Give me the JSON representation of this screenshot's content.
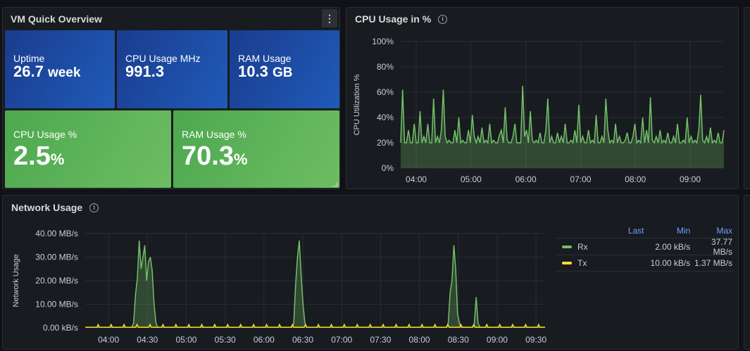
{
  "overview": {
    "title": "VM Quick Overview",
    "menu_icon": "⋮",
    "uptime": {
      "label": "Uptime",
      "value": "26.7",
      "unit": "week"
    },
    "cpu_mhz": {
      "label": "CPU Usage MHz",
      "value": "991.3",
      "unit": ""
    },
    "ram": {
      "label": "RAM Usage",
      "value": "10.3",
      "unit": "GB"
    },
    "cpu_pct": {
      "label": "CPU Usage %",
      "value": "2.5",
      "unit": "%"
    },
    "ram_pct": {
      "label": "RAM Usage %",
      "value": "70.3",
      "unit": "%"
    },
    "colors": {
      "blue": "#1f5bb8",
      "green": "#5fb45a"
    }
  },
  "cpu_panel": {
    "title": "CPU Usage in %",
    "info_icon": "i"
  },
  "network_panel": {
    "title": "Network Usage",
    "info_icon": "i",
    "legend": {
      "headers": [
        "Last",
        "Min",
        "Max"
      ],
      "rows": [
        {
          "name": "Rx",
          "color": "#73bf69",
          "last": "",
          "min": "2.00 kB/s",
          "max": "37.77 MB/s"
        },
        {
          "name": "Tx",
          "color": "#fade2a",
          "last": "",
          "min": "10.00 kB/s",
          "max": "1.37 MB/s"
        }
      ]
    }
  },
  "chart_data": [
    {
      "type": "area",
      "title": "CPU Usage in %",
      "ylabel": "CPU Utilization %",
      "ylim": [
        0,
        100
      ],
      "yticks": [
        "0%",
        "20%",
        "40%",
        "60%",
        "80%",
        "100%"
      ],
      "xticks": [
        "04:00",
        "05:00",
        "06:00",
        "07:00",
        "08:00",
        "09:00"
      ],
      "grid": true,
      "series": [
        {
          "color": "#73bf69",
          "x_range": [
            "03:43",
            "09:37"
          ],
          "values": [
            20,
            62,
            20,
            20,
            30,
            20,
            20,
            35,
            20,
            20,
            45,
            20,
            25,
            20,
            35,
            20,
            20,
            55,
            20,
            25,
            20,
            30,
            62,
            25,
            20,
            22,
            20,
            20,
            30,
            20,
            40,
            20,
            22,
            20,
            20,
            30,
            20,
            42,
            25,
            20,
            25,
            20,
            32,
            20,
            22,
            20,
            35,
            20,
            22,
            20,
            20,
            26,
            30,
            20,
            48,
            22,
            20,
            20,
            25,
            35,
            20,
            20,
            20,
            65,
            25,
            30,
            20,
            45,
            22,
            20,
            22,
            20,
            28,
            20,
            20,
            30,
            55,
            20,
            25,
            20,
            20,
            28,
            20,
            25,
            20,
            35,
            20,
            20,
            22,
            20,
            30,
            20,
            50,
            20,
            25,
            20,
            20,
            30,
            20,
            22,
            20,
            42,
            20,
            20,
            25,
            20,
            55,
            30,
            20,
            22,
            20,
            35,
            20,
            25,
            20,
            20,
            22,
            28,
            20,
            20,
            25,
            35,
            20,
            22,
            20,
            40,
            20,
            30,
            20,
            56,
            22,
            20,
            25,
            20,
            30,
            20,
            22,
            20,
            28,
            20,
            20,
            25,
            20,
            35,
            20,
            20,
            22,
            20,
            40,
            20,
            25,
            20,
            22,
            20,
            30,
            58,
            22,
            20,
            25,
            20,
            32,
            20,
            22,
            20,
            28,
            20,
            20,
            30
          ]
        }
      ]
    },
    {
      "type": "area",
      "title": "Network Usage",
      "ylabel": "Network Usage",
      "ylim": [
        0,
        40
      ],
      "yticks": [
        "0.00 kB/s",
        "10.00 MB/s",
        "20.00 MB/s",
        "30.00 MB/s",
        "40.00 MB/s"
      ],
      "xticks": [
        "04:00",
        "04:30",
        "05:00",
        "05:30",
        "06:00",
        "06:30",
        "07:00",
        "07:30",
        "08:00",
        "08:30",
        "09:00",
        "09:30"
      ],
      "grid": true,
      "series": [
        {
          "name": "Rx",
          "color": "#73bf69",
          "x_range": [
            "03:42",
            "09:37"
          ],
          "values": [
            0.2,
            0.2,
            0.2,
            0.2,
            0.2,
            0.2,
            0.2,
            0.2,
            0.2,
            0.2,
            0.2,
            0.2,
            0.2,
            0.2,
            0.2,
            0.2,
            0.2,
            0.2,
            0.2,
            0.2,
            0.2,
            0.2,
            0.2,
            0.2,
            0.2,
            0.2,
            0.2,
            0.2,
            0.2,
            0.2,
            0.2,
            0.2,
            0.2,
            0.2,
            0.2,
            0.2,
            0.2,
            0.2,
            0.2,
            0.2,
            0.2,
            0.2,
            0.2,
            0.2,
            0.2,
            0.2,
            0.2,
            0.2,
            0.2,
            0.2,
            0.2,
            0.2,
            0.2,
            0.2,
            0.2,
            0.2,
            0.2,
            0.2,
            0.2,
            0.2,
            0.2,
            0.2,
            0.2,
            0.2,
            0.2,
            0.2,
            0.2,
            0.2,
            0.2,
            0.2,
            0.2,
            0.2,
            0.2,
            0.2,
            0.2,
            0.2,
            0.2,
            0.2,
            0.2,
            0.2,
            0.2,
            0.2,
            0.2,
            0.2,
            0.2,
            0.2,
            0.2,
            0.2,
            0.2,
            0.2,
            0.2,
            0.2,
            0.2,
            0.2,
            0.2,
            0.2,
            0.2,
            0.2,
            0.2,
            0.2,
            0.2,
            0.2,
            0.2,
            0.2,
            0.2,
            0.2,
            0.2,
            0.2,
            0.2,
            0.2,
            0.2,
            0.2,
            0.2,
            0.2,
            0.2,
            0.2,
            0.2,
            0.2,
            0.2,
            0.2,
            0.2,
            0.2,
            0.2,
            0.2,
            0.2,
            0.2,
            0.2,
            0.2,
            0.2,
            0.2,
            0.2,
            0.2,
            0.2,
            0.2,
            0.2,
            0.2,
            0.2,
            0.2,
            0.2,
            0.2,
            0.2,
            0.2,
            0.2,
            0.2,
            0.2,
            0.2,
            0.2,
            0.2,
            0.2,
            0.2,
            0.2,
            0.2,
            0.2,
            0.2,
            0.2,
            0.2,
            0.2,
            0.2,
            0.2,
            0.2,
            0.2,
            0.2,
            0.2,
            0.2,
            0.2,
            0.2,
            0.2,
            0.2,
            0.2,
            0.2,
            0.2,
            0.2,
            0.2,
            0.2,
            0.2,
            0.2,
            0.2,
            0.2,
            0.2,
            0.2,
            0.2,
            0.2,
            0.2,
            0.2,
            0.2,
            0.2,
            0.2,
            0.2,
            0.2,
            0.2,
            0.2,
            0.2,
            0.2,
            0.2,
            0.2,
            0.2,
            0.2,
            0.2,
            0.2,
            0.2,
            0.2,
            0.2,
            0.2,
            0.2,
            0.2,
            0.2,
            0.2,
            0.2,
            0.2,
            0.2,
            0.2,
            0.2,
            0.2,
            0.2,
            0.2,
            0.2,
            0.2,
            0.2,
            0.2,
            0.2,
            0.2,
            0.2,
            0.2,
            0.2,
            0.2,
            0.2,
            0.2,
            0.2,
            0.2,
            0.2,
            0.2,
            0.2,
            0.2,
            0.2,
            0.2,
            0.2,
            0.2,
            0.2,
            0.2,
            0.2,
            0.2,
            0.2,
            0.2,
            0.2,
            0.2,
            0.2,
            0.2,
            0.2
          ],
          "spikes": [
            {
              "at": "04:28",
              "values": [
                2,
                14,
                21,
                37,
                25,
                30,
                35,
                20,
                28,
                30,
                24,
                10,
                2
              ]
            },
            {
              "at": "06:27",
              "values": [
                2,
                18,
                30,
                37,
                22,
                10,
                2
              ]
            },
            {
              "at": "08:26",
              "values": [
                2,
                15,
                20,
                35,
                25,
                6,
                2
              ]
            },
            {
              "at": "08:44",
              "values": [
                2,
                13,
                2
              ]
            }
          ]
        },
        {
          "name": "Tx",
          "color": "#fade2a",
          "x_range": [
            "03:42",
            "09:37"
          ],
          "baseline": 0.2,
          "pulse": 1.37,
          "pulse_every_minutes": 10
        }
      ]
    }
  ]
}
